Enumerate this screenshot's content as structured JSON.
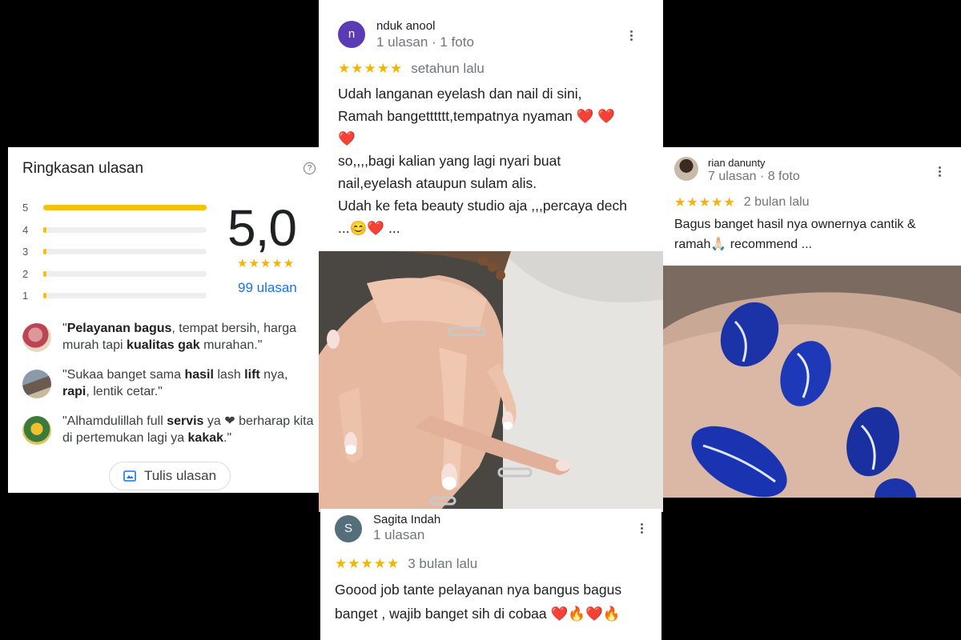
{
  "summary": {
    "title": "Ringkasan ulasan",
    "help_icon": "?",
    "bars": [
      {
        "label": "5",
        "fraction": 1.0
      },
      {
        "label": "4",
        "fraction": 0.01
      },
      {
        "label": "3",
        "fraction": 0.01
      },
      {
        "label": "2",
        "fraction": 0.01
      },
      {
        "label": "1",
        "fraction": 0.01
      }
    ],
    "rating": "5,0",
    "stars": "★★★★★",
    "count": "99 ulasan",
    "snippets": [
      {
        "parts": [
          "\"",
          "Pelayanan bagus",
          ", tempat bersih, harga murah tapi ",
          "kualitas gak",
          " murahan.\""
        ]
      },
      {
        "parts": [
          "\"Sukaa banget sama ",
          "hasil",
          " lash ",
          "lift",
          " nya, ",
          "rapi",
          ", lentik cetar.\""
        ]
      },
      {
        "parts": [
          "\"Alhamdulillah full ",
          "servis",
          " ya ❤ berharap kita di pertemukan lagi ya ",
          "kakak",
          ".\""
        ]
      }
    ],
    "write_button": "Tulis ulasan"
  },
  "review1": {
    "avatar_letter": "n",
    "name": "nduk anool",
    "meta": "1 ulasan · 1 foto",
    "stars": "★★★★★",
    "when": "setahun lalu",
    "lines": [
      "Udah langanan eyelash dan nail di sini,",
      "Ramah bangetttttt,tempatnya nyaman ❤️ ❤️",
      "❤️",
      "so,,,,bagi kalian yang lagi nyari buat",
      "nail,eyelash ataupun sulam alis.",
      "Udah ke feta beauty studio aja ,,,percaya dech",
      "...😊❤️ ..."
    ]
  },
  "review2": {
    "name": "rian danunty",
    "meta": "7 ulasan · 8 foto",
    "stars": "★★★★★",
    "when": "2 bulan lalu",
    "lines": [
      "Bagus banget hasil nya ownernya cantik &",
      "ramah🙏🏻 recommend ..."
    ]
  },
  "review3": {
    "avatar_letter": "S",
    "name": "Sagita Indah",
    "meta": "1 ulasan",
    "stars": "★★★★★",
    "when": "3 bulan lalu",
    "lines": [
      "Goood job tante pelayanan nya bangus bagus",
      "banget , wajib banget sih di cobaa ❤️🔥❤️🔥",
      "..."
    ]
  },
  "colors": {
    "accent": "#1a73e8",
    "star": "#f4b400",
    "bar": "#f4c20d",
    "avatar_n": "#5b3bb5",
    "avatar_s": "#546e7a"
  },
  "icons": [
    "help-icon",
    "kebab-menu-icon",
    "write-review-icon"
  ]
}
